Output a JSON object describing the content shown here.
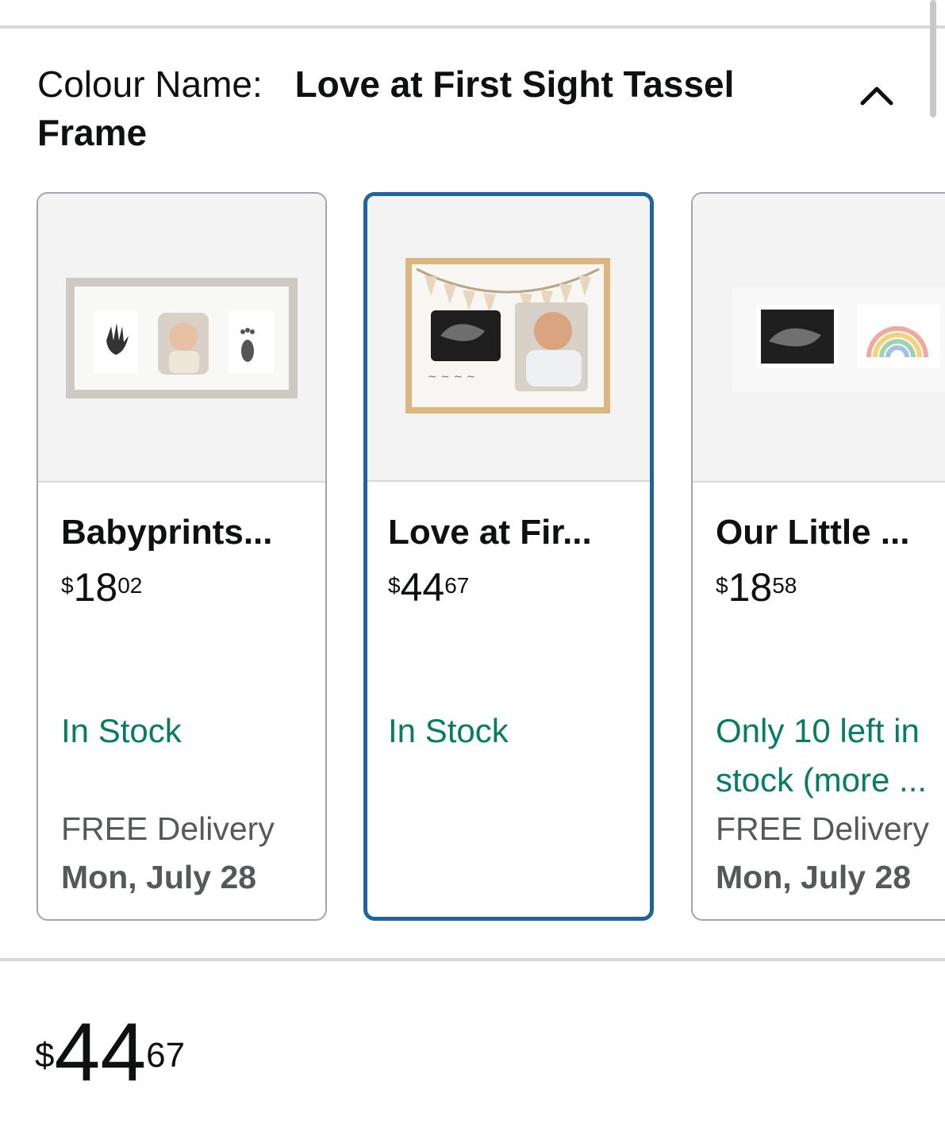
{
  "colour": {
    "label": "Colour Name:",
    "value": "Love at First Sight Tassel Frame"
  },
  "options": [
    {
      "name": "Babyprints...",
      "price_symbol": "$",
      "price_whole": "18",
      "price_fraction": "02",
      "availability": "In Stock",
      "delivery_line1": "FREE Delivery",
      "delivery_line2": "Mon, July 28"
    },
    {
      "name": "Love at Fir...",
      "price_symbol": "$",
      "price_whole": "44",
      "price_fraction": "67",
      "availability": "In Stock",
      "selected": true
    },
    {
      "name": "Our Little ...",
      "price_symbol": "$",
      "price_whole": "18",
      "price_fraction": "58",
      "availability_line1": "Only 10 left in",
      "availability_line2": "stock (more ...",
      "delivery_line1": "FREE Delivery",
      "delivery_line2": "Mon, July 28"
    }
  ],
  "price": {
    "symbol": "$",
    "whole": "44",
    "fraction": "67"
  },
  "colors": {
    "accent_selected": "#2162a1",
    "stock_green": "#067d62",
    "muted_text": "#565959"
  },
  "icons": {
    "collapse": "chevron-up-icon"
  }
}
